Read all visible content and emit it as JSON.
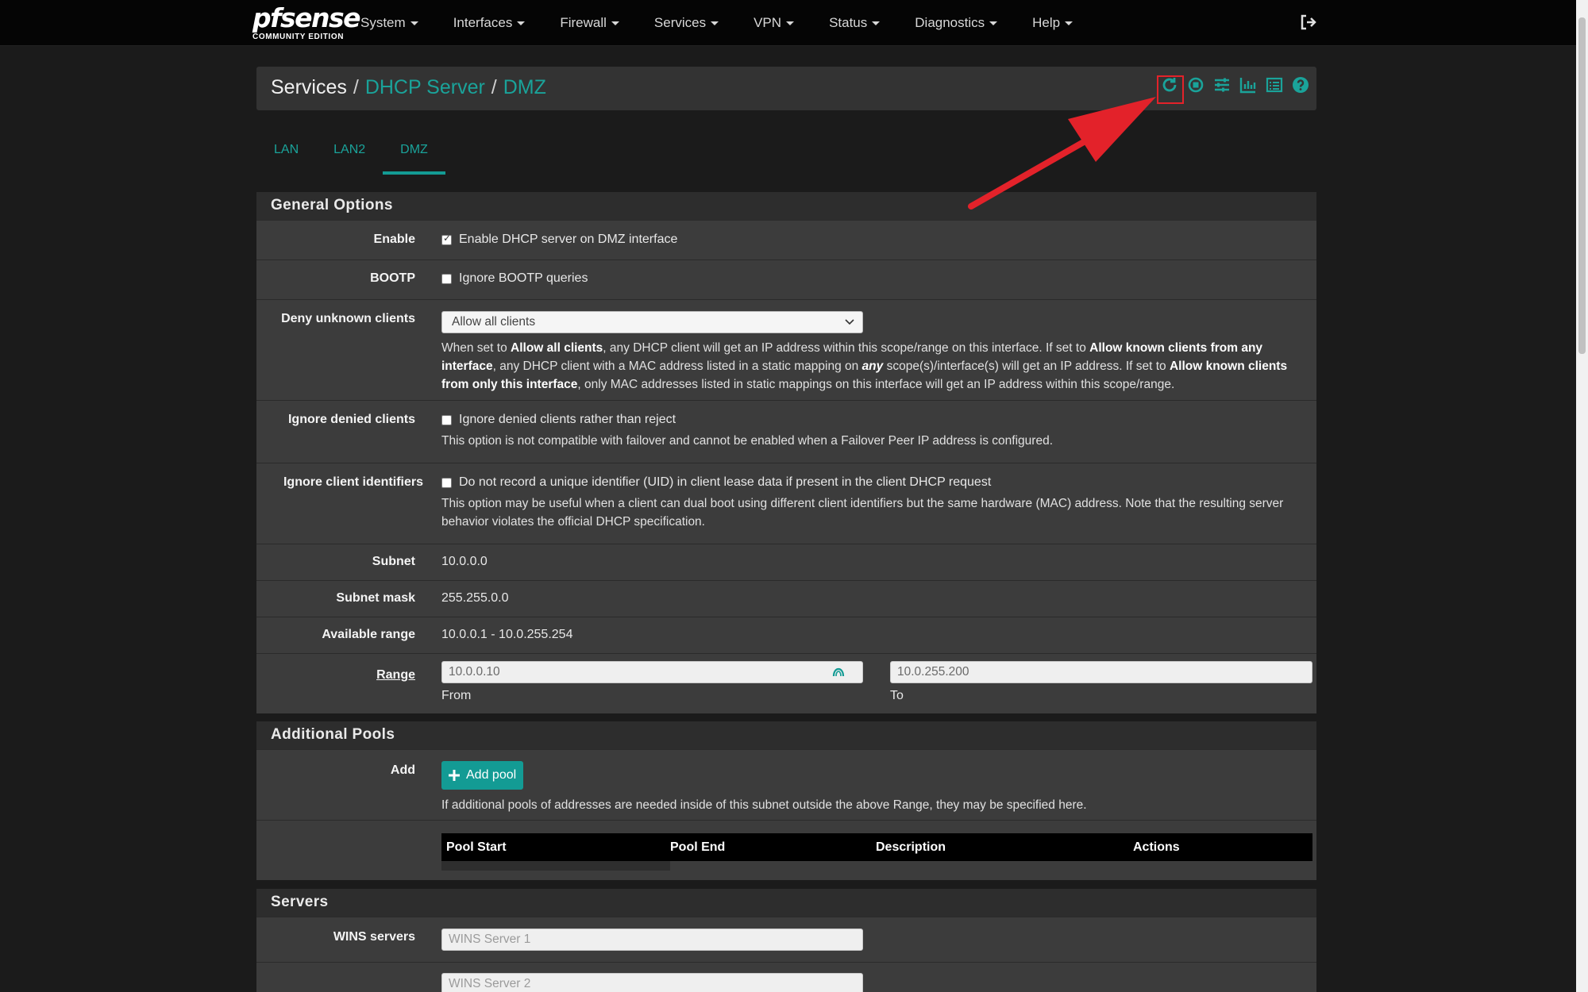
{
  "brand": {
    "name": "pfsense",
    "edition": "COMMUNITY EDITION"
  },
  "nav": {
    "items": [
      {
        "label": "System"
      },
      {
        "label": "Interfaces"
      },
      {
        "label": "Firewall"
      },
      {
        "label": "Services"
      },
      {
        "label": "VPN"
      },
      {
        "label": "Status"
      },
      {
        "label": "Diagnostics"
      },
      {
        "label": "Help"
      }
    ],
    "logout_icon": "sign-out-icon"
  },
  "breadcrumb": {
    "root": "Services",
    "sep": "/",
    "level1": "DHCP Server",
    "level2": "DMZ",
    "icons": [
      "restart-icon",
      "stop-icon",
      "sliders-icon",
      "bar-chart-icon",
      "log-list-icon",
      "help-icon"
    ]
  },
  "tabs": [
    {
      "label": "LAN",
      "active": false
    },
    {
      "label": "LAN2",
      "active": false
    },
    {
      "label": "DMZ",
      "active": true
    }
  ],
  "general": {
    "title": "General Options",
    "enable": {
      "label": "Enable",
      "text": "Enable DHCP server on DMZ interface",
      "checked": true
    },
    "bootp": {
      "label": "BOOTP",
      "text": "Ignore BOOTP queries",
      "checked": false
    },
    "deny": {
      "label": "Deny unknown clients",
      "selected": "Allow all clients",
      "help_p1": "When set to ",
      "help_b1": "Allow all clients",
      "help_p2": ", any DHCP client will get an IP address within this scope/range on this interface. If set to ",
      "help_b2": "Allow known clients from any interface",
      "help_p3": ", any DHCP client with a MAC address listed in a static mapping on ",
      "help_i1": "any",
      "help_p4": " scope(s)/interface(s) will get an IP address. If set to ",
      "help_b3": "Allow known clients from only this interface",
      "help_p5": ", only MAC addresses listed in static mappings on this interface will get an IP address within this scope/range."
    },
    "ignore_denied": {
      "label": "Ignore denied clients",
      "text": "Ignore denied clients rather than reject",
      "checked": false,
      "help": "This option is not compatible with failover and cannot be enabled when a Failover Peer IP address is configured."
    },
    "ignore_uid": {
      "label": "Ignore client identifiers",
      "text": "Do not record a unique identifier (UID) in client lease data if present in the client DHCP request",
      "checked": false,
      "help": "This option may be useful when a client can dual boot using different client identifiers but the same hardware (MAC) address. Note that the resulting server behavior violates the official DHCP specification."
    },
    "subnet": {
      "label": "Subnet",
      "value": "10.0.0.0"
    },
    "mask": {
      "label": "Subnet mask",
      "value": "255.255.0.0"
    },
    "available": {
      "label": "Available range",
      "value": "10.0.0.1 - 10.0.255.254"
    },
    "range": {
      "label": "Range",
      "from_value": "10.0.0.10",
      "from_label": "From",
      "to_value": "10.0.255.200",
      "to_label": "To"
    }
  },
  "pools": {
    "title": "Additional Pools",
    "add_label": "Add",
    "add_button": "Add pool",
    "help": "If additional pools of addresses are needed inside of this subnet outside the above Range, they may be specified here.",
    "columns": [
      "Pool Start",
      "Pool End",
      "Description",
      "Actions"
    ]
  },
  "servers": {
    "title": "Servers",
    "wins_label": "WINS servers",
    "wins1_placeholder": "WINS Server 1",
    "wins2_placeholder": "WINS Server 2"
  },
  "colors": {
    "accent": "#139b94",
    "annotation": "#e3222a",
    "navbar": "#050505"
  }
}
